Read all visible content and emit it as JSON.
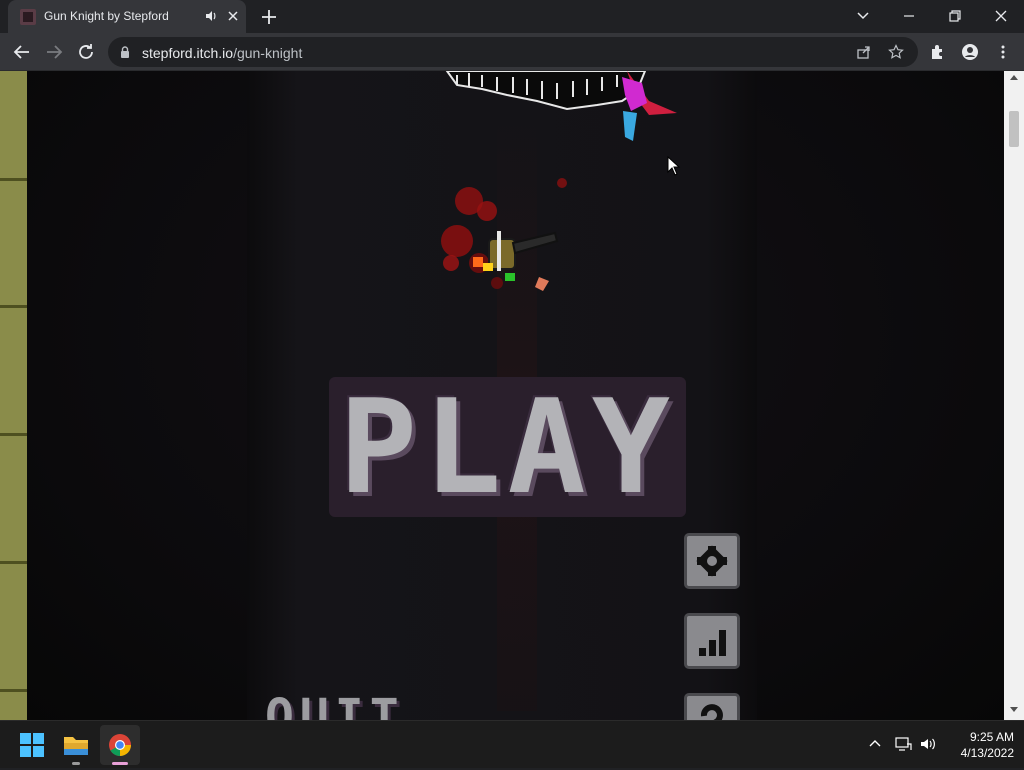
{
  "browser": {
    "tab": {
      "title": "Gun Knight by Stepford"
    },
    "url": {
      "host": "stepford.itch.io",
      "path": "/gun-knight"
    }
  },
  "game": {
    "play_label": "PLAY",
    "quit_label": "QUIT",
    "side_buttons": [
      "settings-icon",
      "leaderboard-icon",
      "help-icon"
    ]
  },
  "taskbar": {
    "apps": [
      "start-icon",
      "file-explorer-icon",
      "chrome-icon"
    ],
    "time": "9:25 AM",
    "date": "4/13/2022"
  }
}
